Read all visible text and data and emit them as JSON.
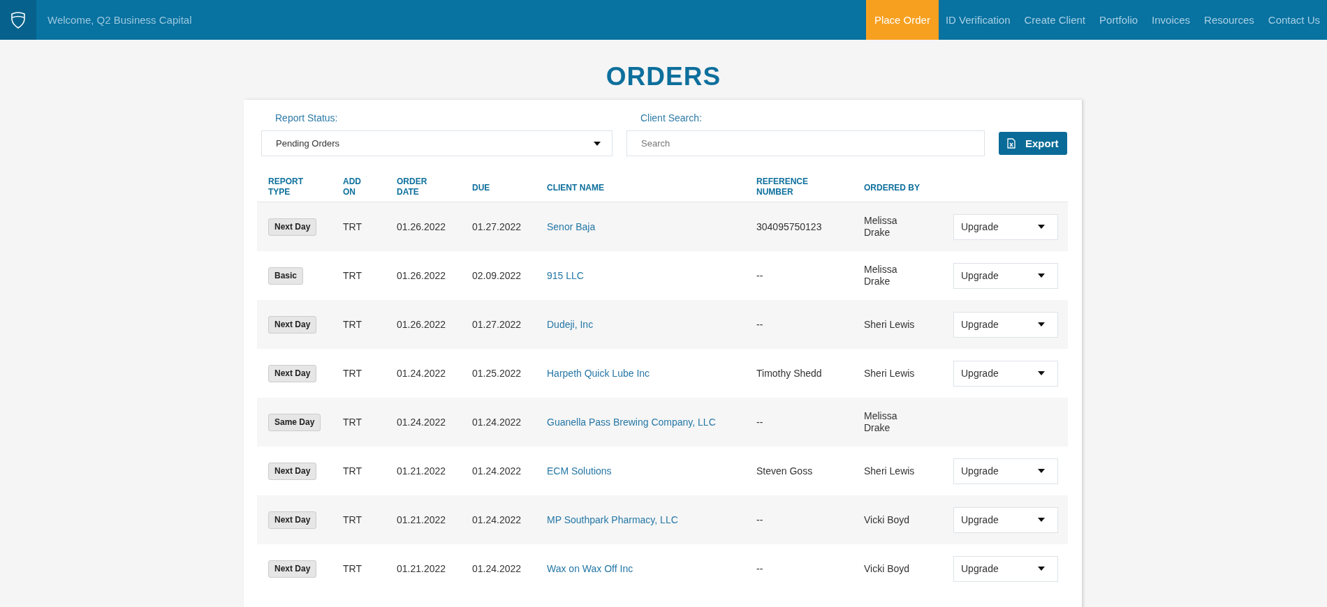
{
  "nav": {
    "welcome": "Welcome, Q2 Business Capital",
    "items": [
      {
        "label": "Place Order",
        "selected": true
      },
      {
        "label": "ID Verification",
        "selected": false
      },
      {
        "label": "Create Client",
        "selected": false
      },
      {
        "label": "Portfolio",
        "selected": false
      },
      {
        "label": "Invoices",
        "selected": false
      },
      {
        "label": "Resources",
        "selected": false
      },
      {
        "label": "Contact Us",
        "selected": false
      }
    ]
  },
  "title": "ORDERS",
  "filters": {
    "report_status": {
      "label": "Report Status:",
      "value": "Pending Orders"
    },
    "client_search": {
      "label": "Client Search:",
      "placeholder": "Search"
    },
    "export_button": "Export"
  },
  "table": {
    "columns": [
      "REPORT TYPE",
      "ADD ON",
      "ORDER DATE",
      "DUE",
      "CLIENT NAME",
      "REFERENCE NUMBER",
      "ORDERED BY"
    ],
    "rows": [
      {
        "report_type": "Next Day",
        "add_on": "TRT",
        "order_date": "01.26.2022",
        "due": "01.27.2022",
        "client_name": "Senor Baja",
        "reference_number": "304095750123",
        "ordered_by": "Melissa Drake",
        "action": "Upgrade"
      },
      {
        "report_type": "Basic",
        "add_on": "TRT",
        "order_date": "01.26.2022",
        "due": "02.09.2022",
        "client_name": "915 LLC",
        "reference_number": "--",
        "ordered_by": "Melissa Drake",
        "action": "Upgrade"
      },
      {
        "report_type": "Next Day",
        "add_on": "TRT",
        "order_date": "01.26.2022",
        "due": "01.27.2022",
        "client_name": "Dudeji, Inc",
        "reference_number": "--",
        "ordered_by": "Sheri Lewis",
        "action": "Upgrade"
      },
      {
        "report_type": "Next Day",
        "add_on": "TRT",
        "order_date": "01.24.2022",
        "due": "01.25.2022",
        "client_name": "Harpeth Quick Lube Inc",
        "reference_number": "Timothy Shedd",
        "ordered_by": "Sheri Lewis",
        "action": "Upgrade"
      },
      {
        "report_type": "Same Day",
        "add_on": "TRT",
        "order_date": "01.24.2022",
        "due": "01.24.2022",
        "client_name": "Guanella Pass Brewing Company, LLC",
        "reference_number": "--",
        "ordered_by": "Melissa Drake"
      },
      {
        "report_type": "Next Day",
        "add_on": "TRT",
        "order_date": "01.21.2022",
        "due": "01.24.2022",
        "client_name": "ECM Solutions",
        "reference_number": "Steven Goss",
        "ordered_by": "Sheri Lewis",
        "action": "Upgrade"
      },
      {
        "report_type": "Next Day",
        "add_on": "TRT",
        "order_date": "01.21.2022",
        "due": "01.24.2022",
        "client_name": "MP Southpark Pharmacy, LLC",
        "reference_number": "--",
        "ordered_by": "Vicki Boyd",
        "action": "Upgrade"
      },
      {
        "report_type": "Next Day",
        "add_on": "TRT",
        "order_date": "01.21.2022",
        "due": "01.24.2022",
        "client_name": "Wax on Wax Off Inc",
        "reference_number": "--",
        "ordered_by": "Vicki Boyd",
        "action": "Upgrade"
      }
    ]
  }
}
